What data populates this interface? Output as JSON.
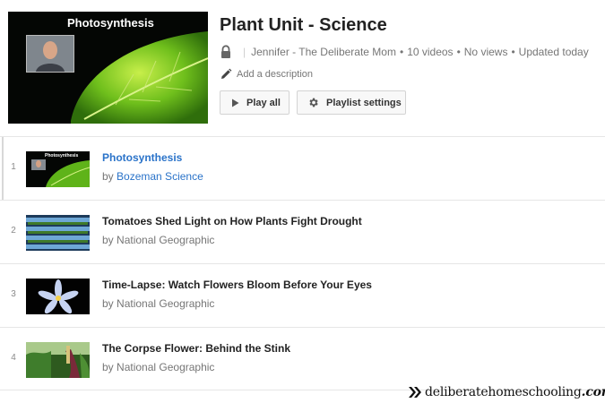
{
  "playlist": {
    "title": "Plant Unit - Science",
    "owner": "Jennifer - The Deliberate Mom",
    "video_count": "10 videos",
    "views": "No views",
    "updated": "Updated today",
    "privacy_icon": "lock-icon",
    "add_description": "Add a description",
    "hero_title": "Photosynthesis"
  },
  "actions": {
    "play_all": "Play all",
    "playlist_settings": "Playlist settings"
  },
  "videos": [
    {
      "index": "1",
      "title": "Photosynthesis",
      "by": "by",
      "channel": "Bozeman Science",
      "thumb_title": "Photosynthesis"
    },
    {
      "index": "2",
      "title": "Tomatoes Shed Light on How Plants Fight Drought",
      "by": "by",
      "channel": "National Geographic"
    },
    {
      "index": "3",
      "title": "Time-Lapse: Watch Flowers Bloom Before Your Eyes",
      "by": "by",
      "channel": "National Geographic"
    },
    {
      "index": "4",
      "title": "The Corpse Flower: Behind the Stink",
      "by": "by",
      "channel": "National Geographic"
    }
  ],
  "watermark": {
    "name": "deliberatehomeschooling",
    "tld": ".com"
  },
  "colors": {
    "link": "#2a73c9",
    "meta": "#767676",
    "button_bg": "#f8f8f8"
  }
}
